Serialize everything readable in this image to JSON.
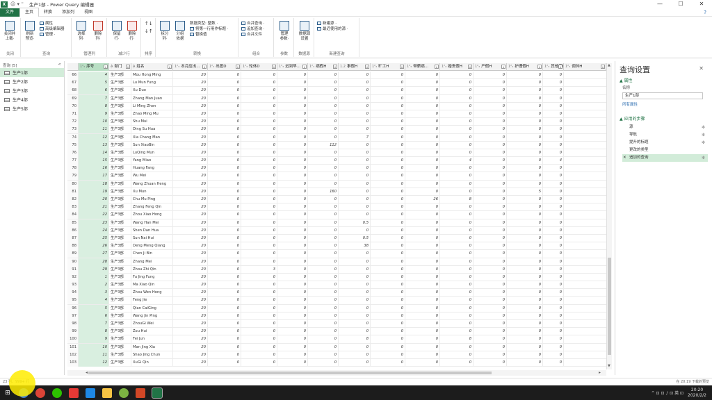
{
  "window": {
    "title": "生产1部 - Power Query 编辑器",
    "minimize": "—",
    "maximize": "☐",
    "close": "✕"
  },
  "ribbon_tabs": [
    "文件",
    "主页",
    "转换",
    "添加列",
    "视图"
  ],
  "ribbon": {
    "groups": [
      {
        "label": "关闭"
      },
      {
        "label": "查询"
      },
      {
        "label": "管理列"
      },
      {
        "label": "减少行"
      },
      {
        "label": "排序"
      },
      {
        "label": "转换"
      },
      {
        "label": "组合"
      },
      {
        "label": "参数"
      },
      {
        "label": "数据源"
      },
      {
        "label": "新建查询"
      }
    ],
    "close_apply": "关闭并\n上载·",
    "refresh_preview": "刷新\n预览·",
    "properties": "属性",
    "advanced_editor": "高级编辑器",
    "manage": "管理 ·",
    "choose_columns": "选择\n列·",
    "remove_columns": "删除\n列·",
    "keep_rows": "保留\n行·",
    "remove_rows": "删除\n行·",
    "split_column": "拆分\n列·",
    "group_by": "分组\n依据",
    "data_type": "数据类型: 整数 ·",
    "use_first_row": "将第一行用作标题 ·",
    "replace_values": "替换值",
    "merge_queries": "合并查询 ·",
    "append_queries": "追加查询 ·",
    "combine_files": "合并文件",
    "manage_params": "管理\n参数·",
    "datasource_settings": "数据源\n设置",
    "new_source": "新建源 ·",
    "recent_sources": "最近使用的源 ·"
  },
  "queries_pane": {
    "header": "查询 [5]",
    "collapse": "<",
    "items": [
      "生产1部",
      "生产2部",
      "生产3部",
      "生产4部",
      "生产5部"
    ]
  },
  "grid": {
    "columns": [
      {
        "type": "1²₃",
        "name": "序号"
      },
      {
        "type": "A᷂",
        "name": "部门"
      },
      {
        "type": "A᷂",
        "name": "姓名"
      },
      {
        "type": "1²₃",
        "name": "本月应出..."
      },
      {
        "type": "1²₃",
        "name": "出差D"
      },
      {
        "type": "1²₃",
        "name": "轮休D"
      },
      {
        "type": "1²₃",
        "name": "迟到早..."
      },
      {
        "type": "1²₃",
        "name": "病假H"
      },
      {
        "type": "1.2",
        "name": "事假H"
      },
      {
        "type": "1²₃",
        "name": "旷工H"
      },
      {
        "type": "1²₃",
        "name": "带薪病..."
      },
      {
        "type": "1²₃",
        "name": "婚丧假H"
      },
      {
        "type": "1²₃",
        "name": "产假H"
      },
      {
        "type": "1²₃",
        "name": "护理假H"
      },
      {
        "type": "1²₃",
        "name": "其他假H"
      },
      {
        "type": "1²₃",
        "name": "调休H"
      }
    ],
    "rows": [
      [
        "66",
        "4",
        "生产3部",
        "Mou Hong Ming",
        "20",
        "0",
        "0",
        "0",
        "0",
        "0",
        "0",
        "0",
        "0",
        "0",
        "0",
        "0"
      ],
      [
        "67",
        "5",
        "生产3部",
        "Lu Mun Fung",
        "20",
        "0",
        "0",
        "0",
        "0",
        "0",
        "0",
        "0",
        "0",
        "0",
        "0",
        "0"
      ],
      [
        "68",
        "6",
        "生产3部",
        "Xu Duo",
        "20",
        "0",
        "0",
        "0",
        "0",
        "0",
        "0",
        "0",
        "0",
        "0",
        "0",
        "0"
      ],
      [
        "69",
        "7",
        "生产3部",
        "Zhang Man Juan",
        "20",
        "0",
        "0",
        "0",
        "0",
        "0",
        "0",
        "0",
        "0",
        "0",
        "0",
        "0"
      ],
      [
        "70",
        "8",
        "生产3部",
        "Li Ming Zhen",
        "20",
        "0",
        "0",
        "0",
        "0",
        "0",
        "0",
        "0",
        "0",
        "0",
        "0",
        "0"
      ],
      [
        "71",
        "9",
        "生产3部",
        "Zhao Ming Mu",
        "20",
        "0",
        "0",
        "0",
        "0",
        "0",
        "0",
        "0",
        "0",
        "0",
        "0",
        "0"
      ],
      [
        "72",
        "10",
        "生产3部",
        "Shu Mui",
        "20",
        "0",
        "0",
        "0",
        "0",
        "0",
        "0",
        "0",
        "0",
        "0",
        "0",
        "0"
      ],
      [
        "73",
        "11",
        "生产3部",
        "Ding Su Hua",
        "20",
        "0",
        "0",
        "0",
        "0",
        "0",
        "0",
        "0",
        "0",
        "0",
        "0",
        "0"
      ],
      [
        "74",
        "12",
        "生产3部",
        "Xia Chang Man",
        "20",
        "0",
        "0",
        "0",
        "0",
        "7",
        "0",
        "0",
        "0",
        "0",
        "0",
        "0"
      ],
      [
        "75",
        "13",
        "生产3部",
        "Sun XiaoBin",
        "20",
        "0",
        "0",
        "0",
        "112",
        "0",
        "0",
        "0",
        "0",
        "0",
        "0",
        "0"
      ],
      [
        "76",
        "14",
        "生产3部",
        "LuQing Mun",
        "20",
        "0",
        "0",
        "0",
        "0",
        "0",
        "0",
        "0",
        "0",
        "0",
        "0",
        "0"
      ],
      [
        "77",
        "15",
        "生产3部",
        "Yang Miao",
        "20",
        "0",
        "0",
        "0",
        "0",
        "0",
        "0",
        "0",
        "4",
        "0",
        "0",
        "4"
      ],
      [
        "78",
        "16",
        "生产3部",
        "Huang Fang",
        "20",
        "0",
        "0",
        "0",
        "0",
        "0",
        "0",
        "0",
        "0",
        "0",
        "0",
        "0"
      ],
      [
        "79",
        "17",
        "生产3部",
        "Wu Mei",
        "20",
        "0",
        "0",
        "0",
        "0",
        "0",
        "0",
        "0",
        "0",
        "0",
        "0",
        "0"
      ],
      [
        "80",
        "18",
        "生产3部",
        "Wang Zhuan Heng",
        "20",
        "0",
        "0",
        "0",
        "0",
        "0",
        "0",
        "0",
        "0",
        "0",
        "0",
        "0"
      ],
      [
        "81",
        "19",
        "生产3部",
        "Xu Mun",
        "20",
        "0",
        "0",
        "0",
        "160",
        "0",
        "0",
        "0",
        "0",
        "0",
        "5",
        "0"
      ],
      [
        "82",
        "20",
        "生产3部",
        "Chu Mu Ping",
        "20",
        "0",
        "0",
        "0",
        "0",
        "0",
        "0",
        "26",
        "8",
        "0",
        "0",
        "0"
      ],
      [
        "83",
        "21",
        "生产3部",
        "Zhang Feng Qin",
        "20",
        "0",
        "0",
        "0",
        "0",
        "0",
        "0",
        "0",
        "0",
        "0",
        "0",
        "0"
      ],
      [
        "84",
        "22",
        "生产3部",
        "Zhou Xiao Hong",
        "20",
        "0",
        "0",
        "0",
        "0",
        "0",
        "0",
        "0",
        "0",
        "0",
        "0",
        "0"
      ],
      [
        "85",
        "23",
        "生产3部",
        "Wang Han Mei",
        "20",
        "0",
        "0",
        "0",
        "0",
        "0.5",
        "0",
        "0",
        "0",
        "0",
        "0",
        "0"
      ],
      [
        "86",
        "24",
        "生产3部",
        "Shen Dan Hua",
        "20",
        "0",
        "0",
        "0",
        "0",
        "0",
        "0",
        "0",
        "0",
        "0",
        "0",
        "0"
      ],
      [
        "87",
        "25",
        "生产3部",
        "Sun Nai Hui",
        "20",
        "0",
        "0",
        "0",
        "0",
        "0.5",
        "0",
        "0",
        "0",
        "0",
        "0",
        "0"
      ],
      [
        "88",
        "26",
        "生产3部",
        "Deng Meng Qiang",
        "20",
        "0",
        "0",
        "0",
        "0",
        "38",
        "0",
        "0",
        "0",
        "0",
        "0",
        "0"
      ],
      [
        "89",
        "27",
        "生产3部",
        "Chen Ji Bin",
        "20",
        "0",
        "0",
        "0",
        "0",
        "0",
        "0",
        "0",
        "0",
        "0",
        "0",
        "0"
      ],
      [
        "90",
        "28",
        "生产3部",
        "Zhang Mei",
        "20",
        "0",
        "0",
        "0",
        "0",
        "0",
        "0",
        "0",
        "0",
        "0",
        "0",
        "0"
      ],
      [
        "91",
        "29",
        "生产3部",
        "Zhou Zhi Qin",
        "20",
        "0",
        "3",
        "0",
        "0",
        "0",
        "0",
        "0",
        "0",
        "0",
        "0",
        "0"
      ],
      [
        "92",
        "1",
        "生产3部",
        "Fu Jing Fung",
        "20",
        "0",
        "0",
        "0",
        "0",
        "0",
        "0",
        "0",
        "0",
        "0",
        "0",
        "0"
      ],
      [
        "93",
        "2",
        "生产3部",
        "Ma Xiao Qin",
        "20",
        "0",
        "0",
        "0",
        "0",
        "0",
        "0",
        "0",
        "0",
        "0",
        "0",
        "0"
      ],
      [
        "94",
        "3",
        "生产3部",
        "Zhou Wen Hong",
        "20",
        "0",
        "0",
        "0",
        "0",
        "0",
        "0",
        "0",
        "0",
        "0",
        "0",
        "0"
      ],
      [
        "95",
        "4",
        "生产3部",
        "Feng Jie",
        "20",
        "0",
        "0",
        "0",
        "0",
        "0",
        "0",
        "0",
        "0",
        "0",
        "0",
        "0"
      ],
      [
        "96",
        "5",
        "生产3部",
        "Qian CaiGing",
        "20",
        "0",
        "0",
        "0",
        "0",
        "0",
        "0",
        "0",
        "0",
        "0",
        "0",
        "0"
      ],
      [
        "97",
        "6",
        "生产3部",
        "Wang Jin Ping",
        "20",
        "0",
        "0",
        "0",
        "0",
        "0",
        "0",
        "0",
        "0",
        "0",
        "0",
        "0"
      ],
      [
        "98",
        "7",
        "生产3部",
        "ZhouGi Wei",
        "20",
        "0",
        "0",
        "0",
        "0",
        "0",
        "0",
        "0",
        "0",
        "0",
        "0",
        "0"
      ],
      [
        "99",
        "8",
        "生产3部",
        "Zou Hui",
        "20",
        "0",
        "0",
        "0",
        "0",
        "0",
        "0",
        "0",
        "0",
        "0",
        "0",
        "0"
      ],
      [
        "100",
        "9",
        "生产3部",
        "Fei Jun",
        "20",
        "0",
        "0",
        "0",
        "0",
        "8",
        "0",
        "0",
        "8",
        "0",
        "0",
        "0"
      ],
      [
        "101",
        "10",
        "生产3部",
        "Man Jing Xia",
        "20",
        "0",
        "0",
        "0",
        "0",
        "0",
        "0",
        "0",
        "0",
        "0",
        "0",
        "0"
      ],
      [
        "102",
        "11",
        "生产3部",
        "Shao Jing Chun",
        "20",
        "0",
        "0",
        "0",
        "0",
        "0",
        "0",
        "0",
        "0",
        "0",
        "0",
        "0"
      ],
      [
        "103",
        "12",
        "生产3部",
        "XuGi Qin",
        "20",
        "0",
        "0",
        "0",
        "0",
        "0",
        "0",
        "0",
        "0",
        "0",
        "0",
        "0"
      ]
    ]
  },
  "settings_pane": {
    "title": "查询设置",
    "close": "✕",
    "properties_section": "▲ 属性",
    "name_label": "名称",
    "name_value": "生产1部",
    "all_properties": "所有属性",
    "steps_section": "▲ 应用的步骤",
    "steps": [
      {
        "label": "源",
        "gear": true,
        "active": false
      },
      {
        "label": "导航",
        "gear": true,
        "active": false
      },
      {
        "label": "提升的标题",
        "gear": true,
        "active": false
      },
      {
        "label": "更改的类型",
        "gear": false,
        "active": false
      },
      {
        "label": "追加的查询",
        "gear": true,
        "active": true
      }
    ]
  },
  "statusbar": {
    "left": "23 列、999+ 行",
    "right": "在 20:19 下载的预览"
  },
  "taskbar": {
    "start": "⊞",
    "time": "20:20",
    "date": "2020/2/2",
    "tray": "^ ⊡ ⊡ ♪ ⊡ 英 ⊡"
  },
  "colors": {
    "excel_green": "#217346",
    "selected_query": "#d2ecd9",
    "selected_column": "#d9efe0"
  }
}
